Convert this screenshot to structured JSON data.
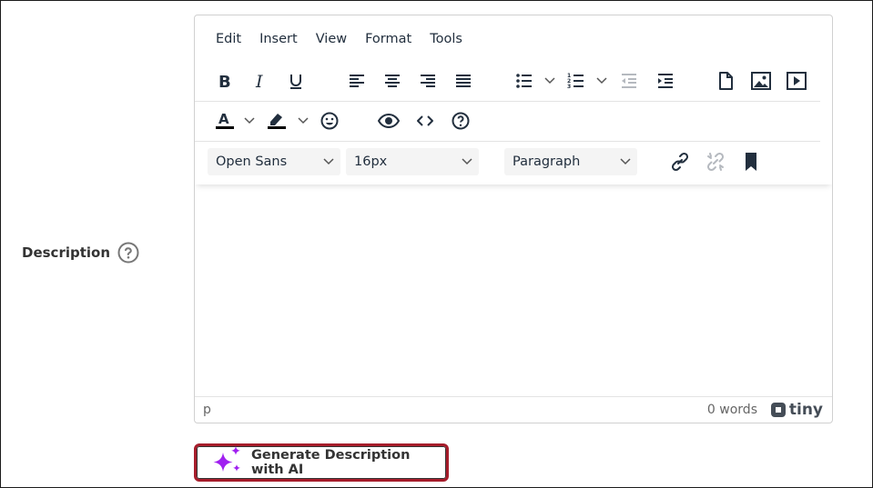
{
  "field": {
    "label": "Description",
    "help_icon": "question-circle-icon"
  },
  "menubar": {
    "items": [
      "Edit",
      "Insert",
      "View",
      "Format",
      "Tools"
    ]
  },
  "toolbar": {
    "row1_icons": [
      "bold-icon",
      "italic-icon",
      "underline-icon",
      "align-left-icon",
      "align-center-icon",
      "align-right-icon",
      "justify-icon",
      "bullet-list-icon",
      "numbered-list-icon",
      "outdent-icon",
      "indent-icon",
      "document-icon",
      "image-icon",
      "media-icon"
    ],
    "row2_icons": [
      "text-color-icon",
      "highlight-icon",
      "emoji-icon",
      "preview-icon",
      "source-code-icon",
      "help-icon"
    ],
    "font_family": "Open Sans",
    "font_size": "16px",
    "block_format": "Paragraph",
    "row3_icons": [
      "link-icon",
      "unlink-icon",
      "bookmark-icon"
    ]
  },
  "statusbar": {
    "path": "p",
    "word_count": "0 words",
    "brand": "tiny"
  },
  "ai_button": {
    "label": "Generate Description with AI",
    "icon": "sparkle-icon",
    "icon_color": "#a020f0",
    "border_color": "#a61d2b"
  }
}
